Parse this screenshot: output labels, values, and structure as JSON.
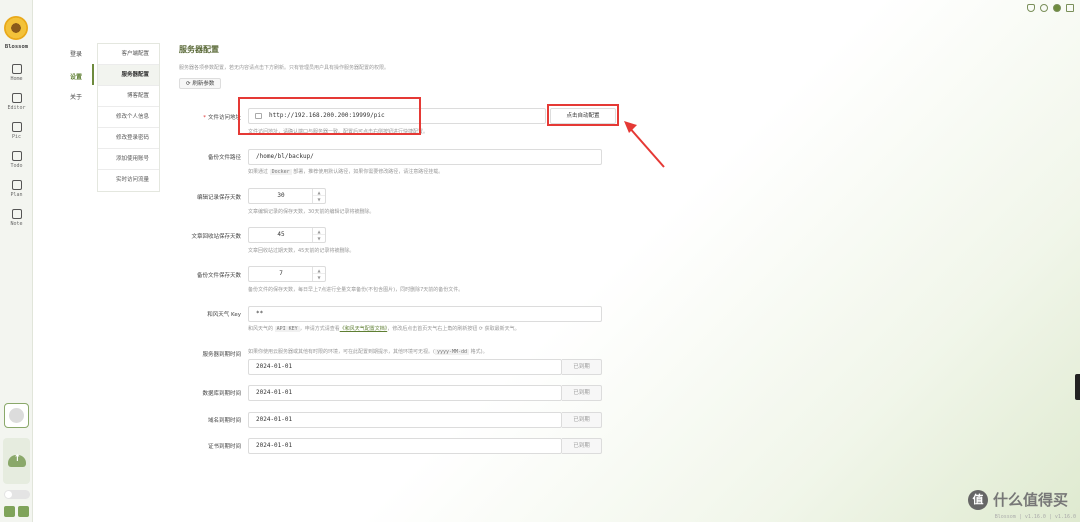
{
  "brand": "Blossom",
  "rail": [
    {
      "label": "Home",
      "icon": "home-icon"
    },
    {
      "label": "Editor",
      "icon": "editor-icon"
    },
    {
      "label": "Pic",
      "icon": "picture-icon"
    },
    {
      "label": "Todo",
      "icon": "todo-icon"
    },
    {
      "label": "Plan",
      "icon": "calendar-icon"
    },
    {
      "label": "Note",
      "icon": "note-icon"
    }
  ],
  "settings_tabs": [
    "登录",
    "设置",
    "关于"
  ],
  "submenu": [
    "客户端配置",
    "服务器配置",
    "博客配置",
    "修改个人信息",
    "修改登录密码",
    "添加使用账号",
    "实时访问流量"
  ],
  "page": {
    "title": "服务器配置",
    "desc": "服务器各项参数配置，若无内容请点击下方刷新。只有管理员用户具有操作服务器配置的权限。",
    "refresh": "刷新参数"
  },
  "form": {
    "file_url": {
      "label": "文件访问地址",
      "required": "*",
      "value": "http://192.168.200.200:19999/pic",
      "hint": "文件访问地址，请确认端口与服务器一致。配置后可点击右侧按钮进行快捷配置。",
      "auto_button": "点击自动配置"
    },
    "backup_path": {
      "label": "备份文件路径",
      "value": "/home/bl/backup/",
      "hint_pre": "如果通过",
      "hint_code": "Docker",
      "hint_post": "部署，推荐使用默认路径，如果你需要修改路径，请注意路径挂载。"
    },
    "edit_days": {
      "label": "编辑记录保存天数",
      "value": "30",
      "hint": "文章编辑记录的保存天数，30天前的编辑记录将被删除。"
    },
    "recycle_days": {
      "label": "文章回收站保存天数",
      "value": "45",
      "hint": "文章回收站过期天数，45天前的记录将被删除。"
    },
    "backup_days": {
      "label": "备份文件保存天数",
      "value": "7",
      "hint": "备份文件的保存天数，每日早上7点进行全量文章备份(不包含图片)，同时删除7天前的备份文件。"
    },
    "weather_key": {
      "label": "和风天气 Key",
      "value": "**",
      "hint_pre": "和风天气的",
      "hint_code": "API KEY",
      "hint_mid": "，申请方式请查看",
      "hint_link": "《和风天气配置文档》",
      "hint_post": "，修改后点击首页天气右上角的刷新按钮 ⟳ 获取最新天气。"
    },
    "server_expire": {
      "label": "服务器到期时间",
      "hint_pre": "如果你使用云服务器或其他有时限的环境，可在此配置到期提示，其他环境可无视。(",
      "hint_code": "yyyy-MM-dd",
      "hint_post": "格式)。",
      "value": "2024-01-01",
      "button": "已到期"
    },
    "db_expire": {
      "label": "数据库到期时间",
      "value": "2024-01-01",
      "button": "已到期"
    },
    "domain_expire": {
      "label": "域名到期时间",
      "value": "2024-01-01",
      "button": "已到期"
    },
    "cert_expire": {
      "label": "证书到期时间",
      "value": "2024-01-01",
      "button": "已到期"
    }
  },
  "watermark": {
    "glyph": "值",
    "text": "什么值得买"
  },
  "footer": "Blossom | v1.16.0 | v1.16.0",
  "colors": {
    "accent": "#6e8b3d",
    "highlight": "#e53935"
  }
}
